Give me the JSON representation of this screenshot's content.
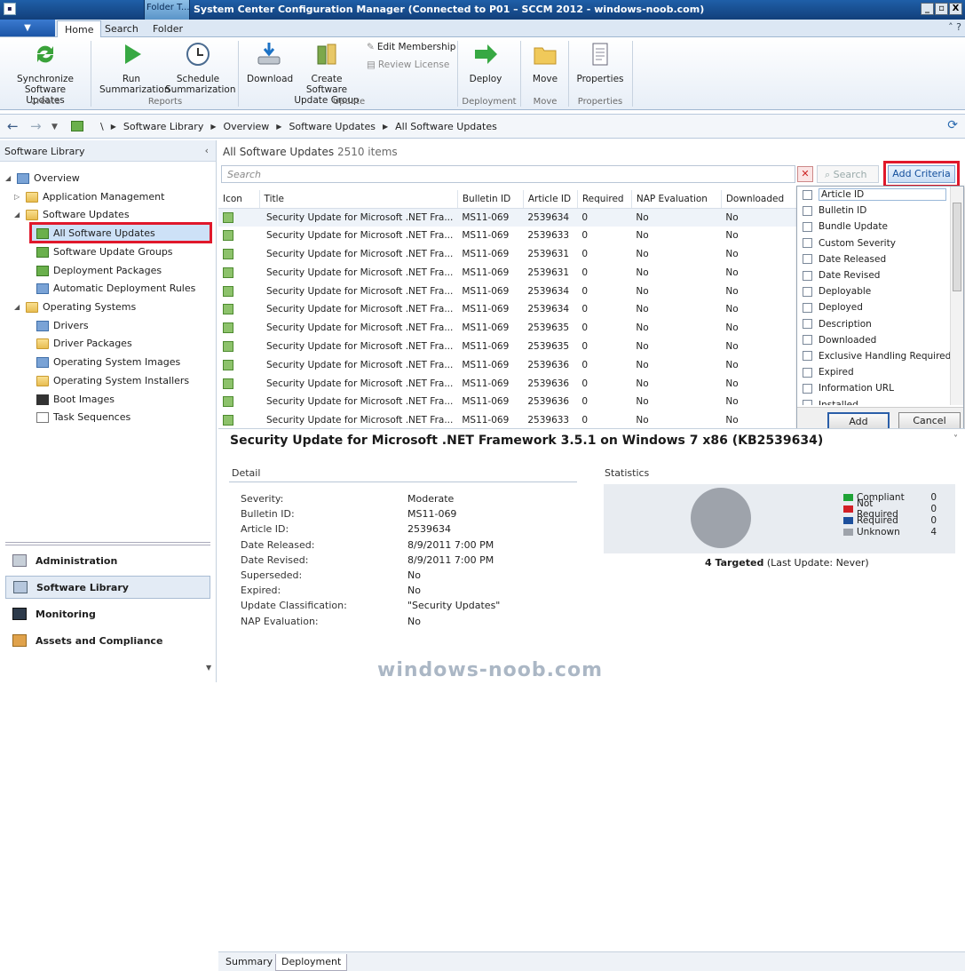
{
  "window": {
    "title": "System Center Configuration Manager (Connected to P01 – SCCM 2012 - windows-noob.com)",
    "context_tab": "Folder T...",
    "min": "_",
    "restore": "▫",
    "close": "X"
  },
  "ribbon_tabs": [
    "Home",
    "Search",
    "Folder"
  ],
  "ribbon": {
    "synchronize": "Synchronize\nSoftware Updates",
    "run": "Run\nSummarization",
    "schedule": "Schedule\nSummarization",
    "download": "Download",
    "create_group": "Create Software\nUpdate Group",
    "edit_membership": "Edit Membership",
    "review_license": "Review License",
    "deploy": "Deploy",
    "move": "Move",
    "properties": "Properties",
    "groups": {
      "create": "Create",
      "reports": "Reports",
      "update": "Update",
      "deployment": "Deployment",
      "move": "Move",
      "properties": "Properties"
    }
  },
  "breadcrumb": [
    "\\",
    "Software Library",
    "Overview",
    "Software Updates",
    "All Software Updates"
  ],
  "left": {
    "header": "Software Library",
    "tree": {
      "overview": "Overview",
      "app_mgmt": "Application Management",
      "software_updates": "Software Updates",
      "all_updates": "All Software Updates",
      "update_groups": "Software Update Groups",
      "deployment_packages": "Deployment Packages",
      "adr": "Automatic Deployment Rules",
      "operating_systems": "Operating Systems",
      "drivers": "Drivers",
      "driver_packages": "Driver Packages",
      "os_images": "Operating System Images",
      "os_installers": "Operating System Installers",
      "boot_images": "Boot Images",
      "task_sequences": "Task Sequences"
    },
    "workspaces": [
      "Administration",
      "Software Library",
      "Monitoring",
      "Assets and Compliance"
    ]
  },
  "main": {
    "title": "All Software Updates",
    "count": "2510 items",
    "search_placeholder": "Search",
    "search_button": "Search",
    "add_criteria": "Add Criteria",
    "columns": [
      "Icon",
      "Title",
      "Bulletin ID",
      "Article ID",
      "Required",
      "NAP Evaluation",
      "Downloaded"
    ],
    "rows": [
      [
        "Security Update for Microsoft .NET Fra...",
        "MS11-069",
        "2539634",
        "0",
        "No",
        "No"
      ],
      [
        "Security Update for Microsoft .NET Fra...",
        "MS11-069",
        "2539633",
        "0",
        "No",
        "No"
      ],
      [
        "Security Update for Microsoft .NET Fra...",
        "MS11-069",
        "2539631",
        "0",
        "No",
        "No"
      ],
      [
        "Security Update for Microsoft .NET Fra...",
        "MS11-069",
        "2539631",
        "0",
        "No",
        "No"
      ],
      [
        "Security Update for Microsoft .NET Fra...",
        "MS11-069",
        "2539634",
        "0",
        "No",
        "No"
      ],
      [
        "Security Update for Microsoft .NET Fra...",
        "MS11-069",
        "2539634",
        "0",
        "No",
        "No"
      ],
      [
        "Security Update for Microsoft .NET Fra...",
        "MS11-069",
        "2539635",
        "0",
        "No",
        "No"
      ],
      [
        "Security Update for Microsoft .NET Fra...",
        "MS11-069",
        "2539635",
        "0",
        "No",
        "No"
      ],
      [
        "Security Update for Microsoft .NET Fra...",
        "MS11-069",
        "2539636",
        "0",
        "No",
        "No"
      ],
      [
        "Security Update for Microsoft .NET Fra...",
        "MS11-069",
        "2539636",
        "0",
        "No",
        "No"
      ],
      [
        "Security Update for Microsoft .NET Fra...",
        "MS11-069",
        "2539636",
        "0",
        "No",
        "No"
      ],
      [
        "Security Update for Microsoft .NET Fra...",
        "MS11-069",
        "2539633",
        "0",
        "No",
        "No"
      ]
    ]
  },
  "criteria": {
    "items": [
      "Article ID",
      "Bulletin ID",
      "Bundle Update",
      "Custom Severity",
      "Date Released",
      "Date Revised",
      "Deployable",
      "Deployed",
      "Description",
      "Downloaded",
      "Exclusive Handling Required",
      "Expired",
      "Information URL",
      "Installed"
    ],
    "add": "Add",
    "cancel": "Cancel"
  },
  "details": {
    "title": "Security Update for Microsoft .NET Framework 3.5.1 on Windows 7 x86 (KB2539634)",
    "detail_label": "Detail",
    "statistics_label": "Statistics",
    "fields": [
      [
        "Severity:",
        "Moderate"
      ],
      [
        "Bulletin ID:",
        "MS11-069"
      ],
      [
        "Article ID:",
        "2539634"
      ],
      [
        "Date Released:",
        "8/9/2011 7:00 PM"
      ],
      [
        "Date Revised:",
        "8/9/2011 7:00 PM"
      ],
      [
        "Superseded:",
        "No"
      ],
      [
        "Expired:",
        "No"
      ],
      [
        "Update Classification:",
        "\"Security Updates\""
      ],
      [
        "NAP Evaluation:",
        "No"
      ]
    ],
    "legend": [
      {
        "label": "Compliant",
        "value": "0",
        "color": "#1fa337"
      },
      {
        "label": "Not Required",
        "value": "0",
        "color": "#d21f26"
      },
      {
        "label": "Required",
        "value": "0",
        "color": "#1d4f9c"
      },
      {
        "label": "Unknown",
        "value": "4",
        "color": "#9ea3ab"
      }
    ],
    "targeted_bold": "4 Targeted",
    "targeted_rest": " (Last Update: Never)"
  },
  "bottom_tabs": [
    "Summary",
    "Deployment"
  ],
  "watermark": "windows-noob.com"
}
